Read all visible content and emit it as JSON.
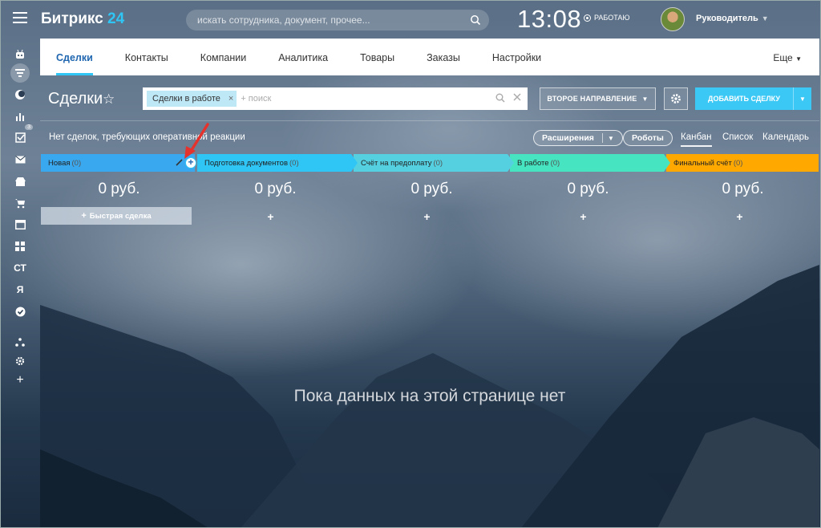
{
  "app": {
    "logo_text": "Битрикс",
    "logo_num": "24",
    "search_placeholder": "искать сотрудника, документ, прочее...",
    "clock": "13:08",
    "work_status": "РАБОТАЮ",
    "user_name": "Руководитель"
  },
  "sidebar": {
    "items": [
      {
        "icon": "robot-icon"
      },
      {
        "icon": "filter-icon"
      },
      {
        "icon": "moon-icon"
      },
      {
        "icon": "bar-chart-icon"
      },
      {
        "icon": "tasks-icon",
        "badge": "3"
      },
      {
        "icon": "mail-icon"
      },
      {
        "icon": "shop-icon"
      },
      {
        "icon": "cart-icon"
      },
      {
        "icon": "window-icon"
      },
      {
        "icon": "apps-icon"
      },
      {
        "icon": "text-icon",
        "label": "СТ"
      },
      {
        "icon": "text-icon",
        "label": "Я"
      },
      {
        "icon": "check-circle-icon"
      },
      {
        "icon": "structure-icon"
      },
      {
        "icon": "gear-icon"
      },
      {
        "icon": "plus-icon"
      }
    ]
  },
  "nav": {
    "tabs": [
      "Сделки",
      "Контакты",
      "Компании",
      "Аналитика",
      "Товары",
      "Заказы",
      "Настройки"
    ],
    "more": "Еще"
  },
  "page": {
    "title": "Сделки",
    "filter_tag": "Сделки в работе",
    "filter_placeholder": "+ поиск",
    "direction_button": "ВТОРОЕ НАПРАВЛЕНИЕ",
    "add_button": "ДОБАВИТЬ СДЕЛКУ",
    "notice": "Нет сделок, требующих оперативной реакции",
    "extensions": "Расширения",
    "robots": "Роботы",
    "views": [
      "Канбан",
      "Список",
      "Календарь"
    ],
    "empty_text": "Пока данных на этой странице нет",
    "quick_deal": "Быстрая сделка"
  },
  "stages": [
    {
      "name": "Новая",
      "count": "(0)",
      "sum": "0 руб.",
      "color": "#39a8ef"
    },
    {
      "name": "Подготовка документов",
      "count": "(0)",
      "sum": "0 руб.",
      "color": "#2fc6f6"
    },
    {
      "name": "Счёт на предоплату",
      "count": "(0)",
      "sum": "0 руб.",
      "color": "#55d0e0"
    },
    {
      "name": "В работе",
      "count": "(0)",
      "sum": "0 руб.",
      "color": "#47e4c2"
    },
    {
      "name": "Финальный счёт",
      "count": "(0)",
      "sum": "0 руб.",
      "color": "#ffa900"
    }
  ],
  "colors": {
    "accent": "#2fc6f6",
    "nav_active": "#2067b0"
  }
}
